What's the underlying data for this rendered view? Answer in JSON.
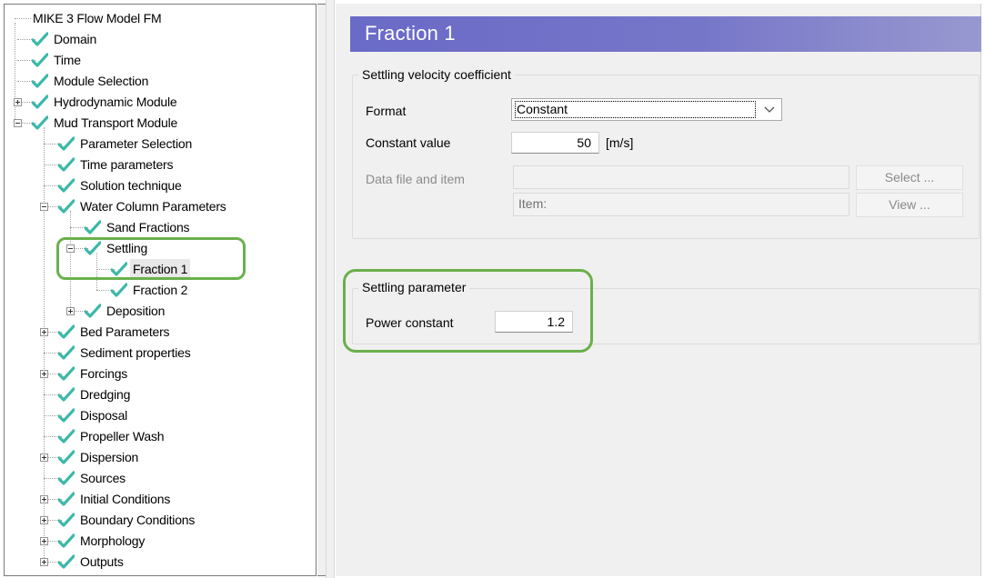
{
  "colors": {
    "check": "#3cb8a8",
    "highlight": "#6ab04c",
    "title_bar": "#6a6ac8"
  },
  "tree": {
    "items": [
      {
        "label": "MIKE 3 Flow Model FM",
        "level": 0,
        "check": false,
        "expander": "none"
      },
      {
        "label": "Domain",
        "level": 1,
        "check": true,
        "expander": "none"
      },
      {
        "label": "Time",
        "level": 1,
        "check": true,
        "expander": "none"
      },
      {
        "label": "Module Selection",
        "level": 1,
        "check": true,
        "expander": "none"
      },
      {
        "label": "Hydrodynamic Module",
        "level": 1,
        "check": true,
        "expander": "plus"
      },
      {
        "label": "Mud Transport Module",
        "level": 1,
        "check": true,
        "expander": "minus"
      },
      {
        "label": "Parameter Selection",
        "level": 2,
        "check": true,
        "expander": "none"
      },
      {
        "label": "Time parameters",
        "level": 2,
        "check": true,
        "expander": "none"
      },
      {
        "label": "Solution technique",
        "level": 2,
        "check": true,
        "expander": "none"
      },
      {
        "label": "Water Column Parameters",
        "level": 2,
        "check": true,
        "expander": "minus"
      },
      {
        "label": "Sand Fractions",
        "level": 3,
        "check": true,
        "expander": "none"
      },
      {
        "label": "Settling",
        "level": 3,
        "check": true,
        "expander": "minus"
      },
      {
        "label": "Fraction 1",
        "level": 4,
        "check": true,
        "expander": "none",
        "selected": true
      },
      {
        "label": "Fraction 2",
        "level": 4,
        "check": true,
        "expander": "none"
      },
      {
        "label": "Deposition",
        "level": 3,
        "check": true,
        "expander": "plus"
      },
      {
        "label": "Bed Parameters",
        "level": 2,
        "check": true,
        "expander": "plus"
      },
      {
        "label": "Sediment properties",
        "level": 2,
        "check": true,
        "expander": "none"
      },
      {
        "label": "Forcings",
        "level": 2,
        "check": true,
        "expander": "plus"
      },
      {
        "label": "Dredging",
        "level": 2,
        "check": true,
        "expander": "none"
      },
      {
        "label": "Disposal",
        "level": 2,
        "check": true,
        "expander": "none"
      },
      {
        "label": "Propeller Wash",
        "level": 2,
        "check": true,
        "expander": "none"
      },
      {
        "label": "Dispersion",
        "level": 2,
        "check": true,
        "expander": "plus"
      },
      {
        "label": "Sources",
        "level": 2,
        "check": true,
        "expander": "none"
      },
      {
        "label": "Initial Conditions",
        "level": 2,
        "check": true,
        "expander": "plus"
      },
      {
        "label": "Boundary Conditions",
        "level": 2,
        "check": true,
        "expander": "plus"
      },
      {
        "label": "Morphology",
        "level": 2,
        "check": true,
        "expander": "plus"
      },
      {
        "label": "Outputs",
        "level": 2,
        "check": true,
        "expander": "plus"
      }
    ]
  },
  "panel": {
    "title": "Fraction 1",
    "settling_velocity": {
      "group_title": "Settling velocity coefficient",
      "format_label": "Format",
      "format_value": "Constant",
      "constant_label": "Constant value",
      "constant_value": "50",
      "constant_unit": "[m/s]",
      "datafile_label": "Data file and item",
      "item_label": "Item:",
      "select_button": "Select ...",
      "view_button": "View ..."
    },
    "settling_parameter": {
      "group_title": "Settling parameter",
      "power_label": "Power constant",
      "power_value": "1.2"
    }
  }
}
